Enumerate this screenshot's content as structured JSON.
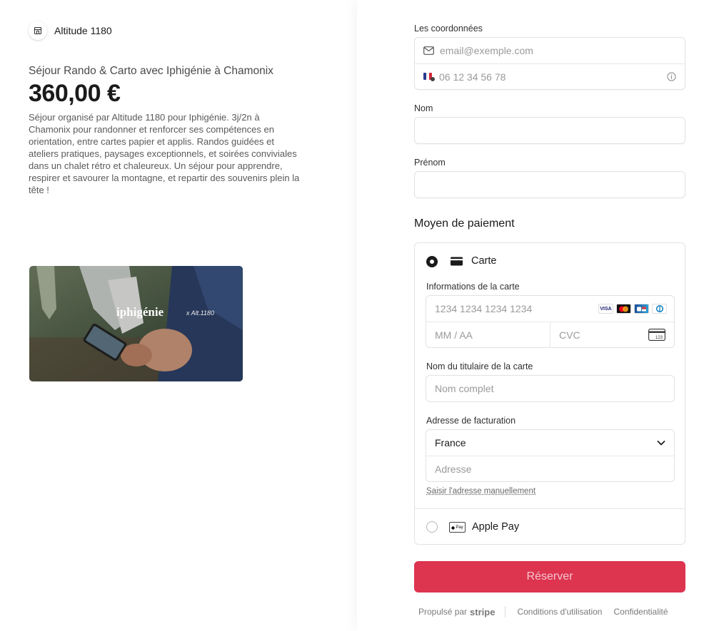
{
  "merchant": {
    "name": "Altitude 1180",
    "icon": "store-icon"
  },
  "product": {
    "name": "Séjour Rando & Carto avec Iphigénie à Chamonix",
    "price": "360,00 €",
    "description": "Séjour organisé par Altitude 1180 pour Iphigénie. 3j/2n à Chamonix pour randonner et renforcer ses compétences en orientation, entre cartes papier et applis. Randos guidées et ateliers pratiques, paysages exceptionnels, et soirées conviviales dans un chalet rétro et chaleureux. Un séjour pour apprendre, respirer et savourer la montagne, et repartir des souvenirs plein la tête !",
    "image_brand": "iphigénie",
    "image_brand_suffix": "x Alt.1180"
  },
  "contact": {
    "label": "Les coordonnées",
    "email_placeholder": "email@exemple.com",
    "phone_placeholder": "06 12 34 56 78"
  },
  "nom": {
    "label": "Nom"
  },
  "prenom": {
    "label": "Prénom"
  },
  "payment": {
    "title": "Moyen de paiement",
    "card_option_label": "Carte",
    "card_info_label": "Informations de la carte",
    "card_number_placeholder": "1234 1234 1234 1234",
    "expiry_placeholder": "MM / AA",
    "cvc_placeholder": "CVC",
    "cvc_icon_text": "123",
    "brands": [
      "VISA",
      "Mastercard",
      "Cartes Bancaires",
      "Diners"
    ],
    "visa_text": "VISA",
    "holder_label": "Nom du titulaire de la carte",
    "holder_placeholder": "Nom complet",
    "billing_label": "Adresse de facturation",
    "country_value": "France",
    "address_placeholder": "Adresse",
    "manual_link": "Saisir l'adresse manuellement",
    "applepay_label": "Apple Pay",
    "applepay_icon_text": "Pay",
    "selected": "Carte"
  },
  "submit_label": "Réserver",
  "footer": {
    "powered_by": "Propulsé par",
    "stripe": "stripe",
    "terms": "Conditions d'utilisation",
    "privacy": "Confidentialité"
  },
  "colors": {
    "accent": "#dd3450",
    "border": "#e2e2e2",
    "text": "#1a1a1a"
  }
}
